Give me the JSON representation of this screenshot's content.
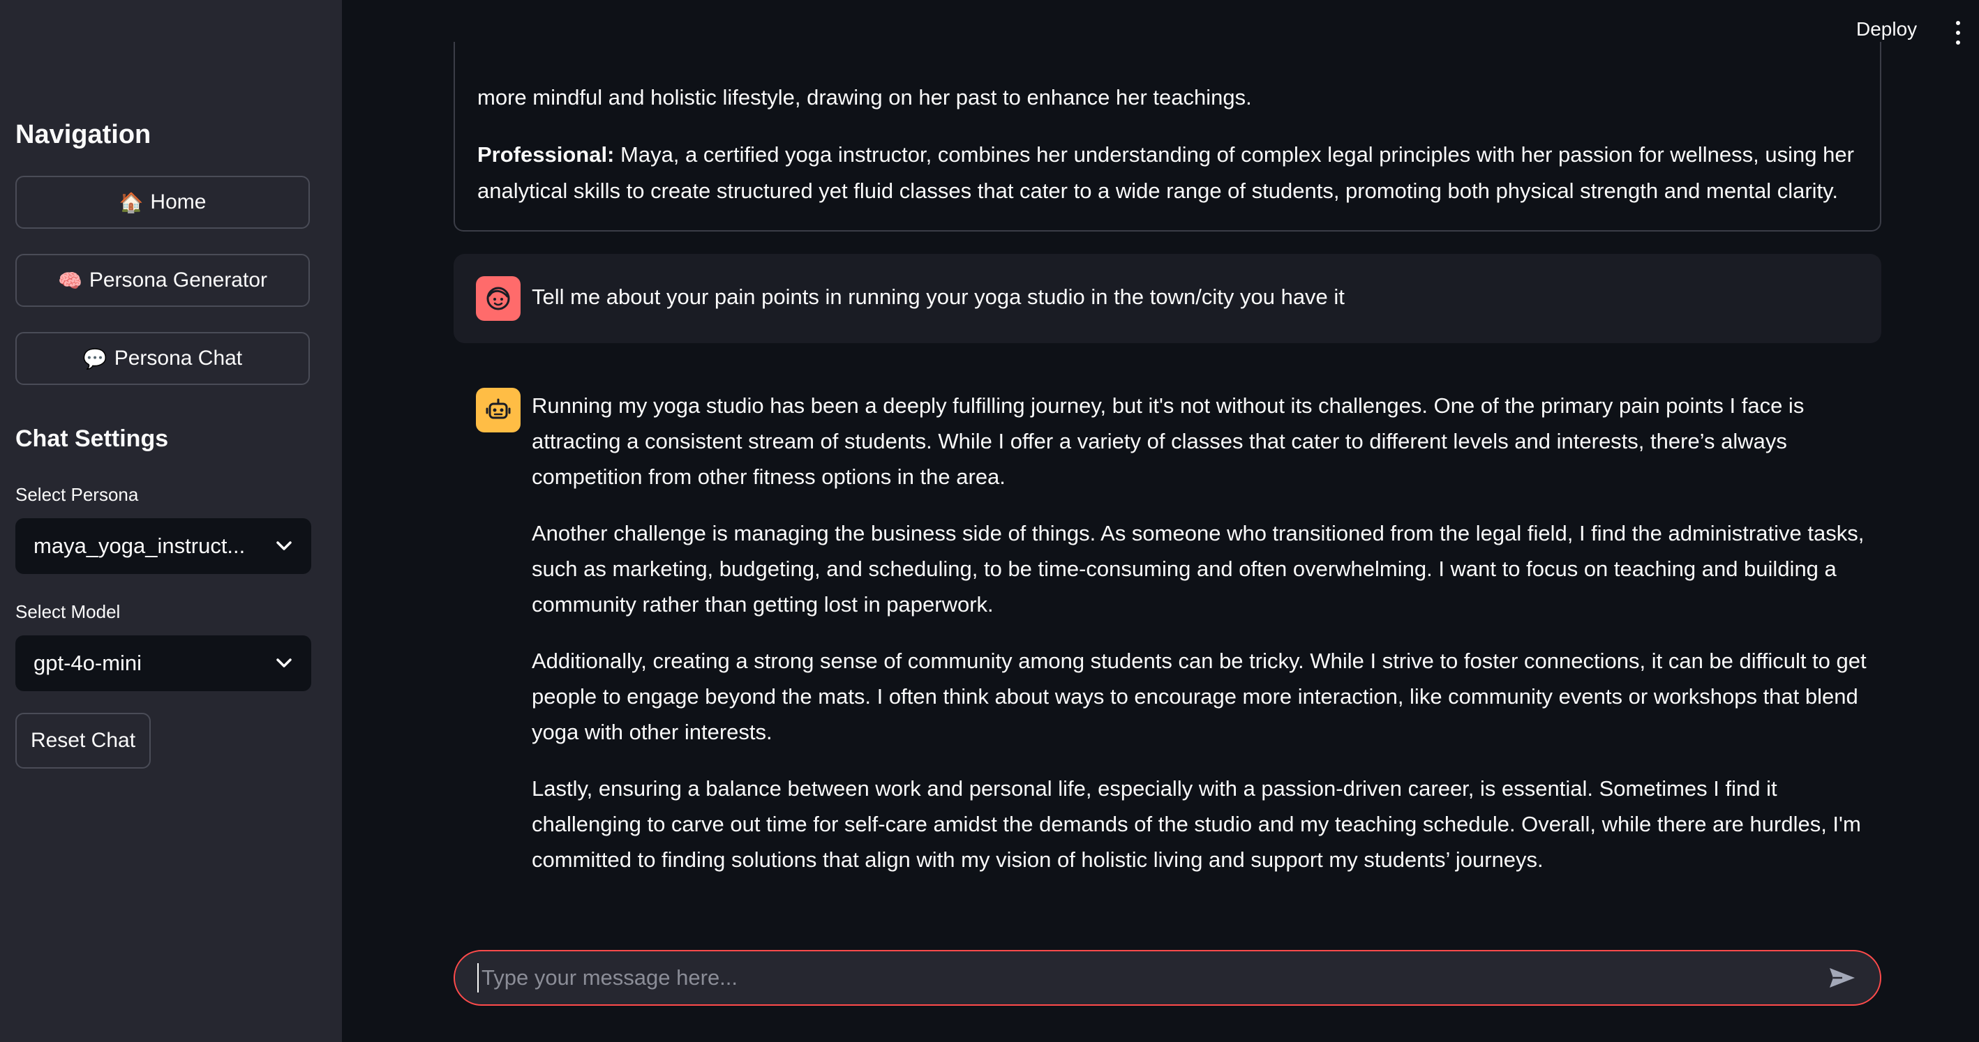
{
  "topbar": {
    "deploy_label": "Deploy"
  },
  "sidebar": {
    "nav_heading": "Navigation",
    "nav_items": [
      {
        "icon": "🏠",
        "label": "Home"
      },
      {
        "icon": "🧠",
        "label": "Persona Generator"
      },
      {
        "icon": "💬",
        "label": "Persona Chat"
      }
    ],
    "settings_heading": "Chat Settings",
    "persona_label": "Select Persona",
    "persona_value": "maya_yoga_instruct...",
    "model_label": "Select Model",
    "model_value": "gpt-4o-mini",
    "reset_label": "Reset Chat"
  },
  "persona_card": {
    "partial_text": "more mindful and holistic lifestyle, drawing on her past to enhance her teachings.",
    "professional_label": "Professional:",
    "professional_text": " Maya, a certified yoga instructor, combines her understanding of complex legal principles with her passion for wellness, using her analytical skills to create structured yet fluid classes that cater to a wide range of students, promoting both physical strength and mental clarity."
  },
  "messages": {
    "user": "Tell me about your pain points in running your yoga studio in the town/city you have it",
    "assistant": [
      "Running my yoga studio has been a deeply fulfilling journey, but it's not without its challenges. One of the primary pain points I face is attracting a consistent stream of students. While I offer a variety of classes that cater to different levels and interests, there’s always competition from other fitness options in the area.",
      "Another challenge is managing the business side of things. As someone who transitioned from the legal field, I find the administrative tasks, such as marketing, budgeting, and scheduling, to be time-consuming and often overwhelming. I want to focus on teaching and building a community rather than getting lost in paperwork.",
      "Additionally, creating a strong sense of community among students can be tricky. While I strive to foster connections, it can be difficult to get people to engage beyond the mats. I often think about ways to encourage more interaction, like community events or workshops that blend yoga with other interests.",
      "Lastly, ensuring a balance between work and personal life, especially with a passion-driven career, is essential. Sometimes I find it challenging to carve out time for self-care amidst the demands of the studio and my teaching schedule. Overall, while there are hurdles, I'm committed to finding solutions that align with my vision of holistic living and support my students’ journeys."
    ]
  },
  "chat_input": {
    "placeholder": "Type your message here..."
  },
  "colors": {
    "accent": "#ff4b4b",
    "user_avatar": "#ff6b6b",
    "bot_avatar": "#ffbd45",
    "sidebar_bg": "#262730",
    "main_bg": "#0e1117"
  }
}
